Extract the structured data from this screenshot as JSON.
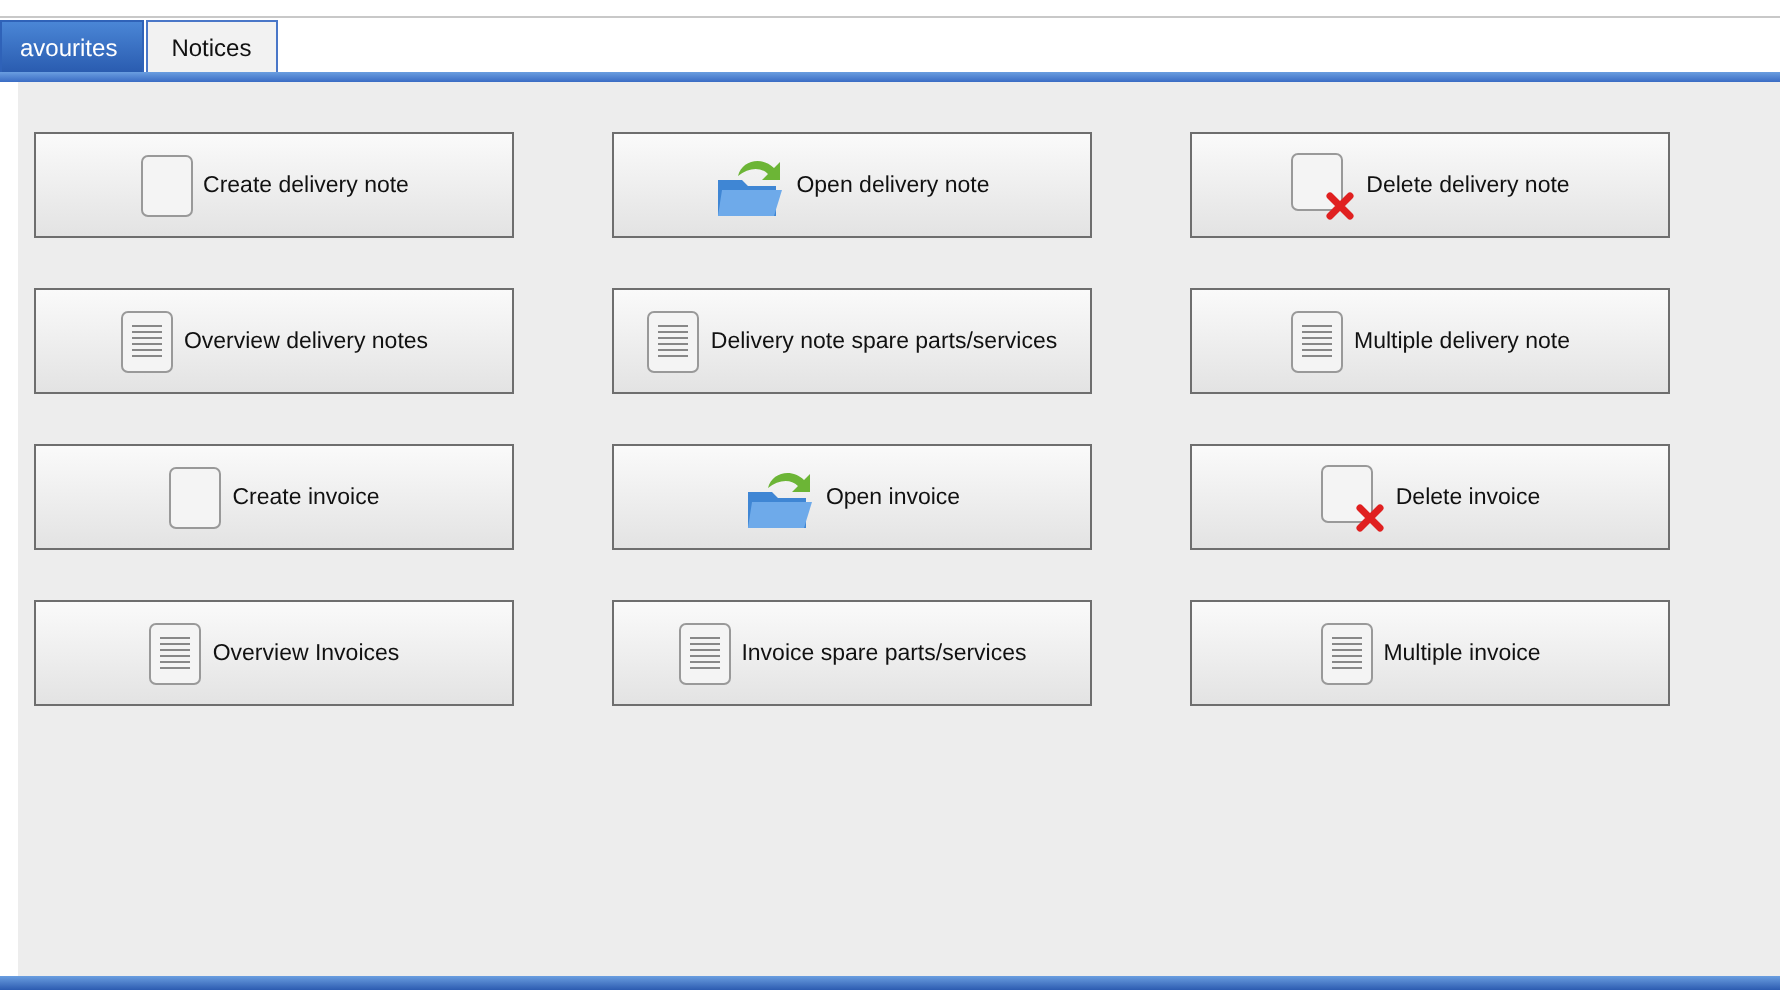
{
  "tabs": [
    {
      "label": "avourites",
      "selected": true
    },
    {
      "label": "Notices",
      "selected": false
    }
  ],
  "buttons": [
    {
      "label": "Create delivery note",
      "kind": "blank"
    },
    {
      "label": "Open delivery note",
      "kind": "open"
    },
    {
      "label": "Delete delivery note",
      "kind": "delete"
    },
    {
      "label": "Overview delivery notes",
      "kind": "list"
    },
    {
      "label": "Delivery note spare parts/services",
      "kind": "list"
    },
    {
      "label": "Multiple delivery note",
      "kind": "list"
    },
    {
      "label": "Create invoice",
      "kind": "blank"
    },
    {
      "label": "Open invoice",
      "kind": "open"
    },
    {
      "label": "Delete invoice",
      "kind": "delete"
    },
    {
      "label": "Overview Invoices",
      "kind": "list"
    },
    {
      "label": "Invoice spare parts/services",
      "kind": "list"
    },
    {
      "label": "Multiple invoice",
      "kind": "list"
    }
  ]
}
